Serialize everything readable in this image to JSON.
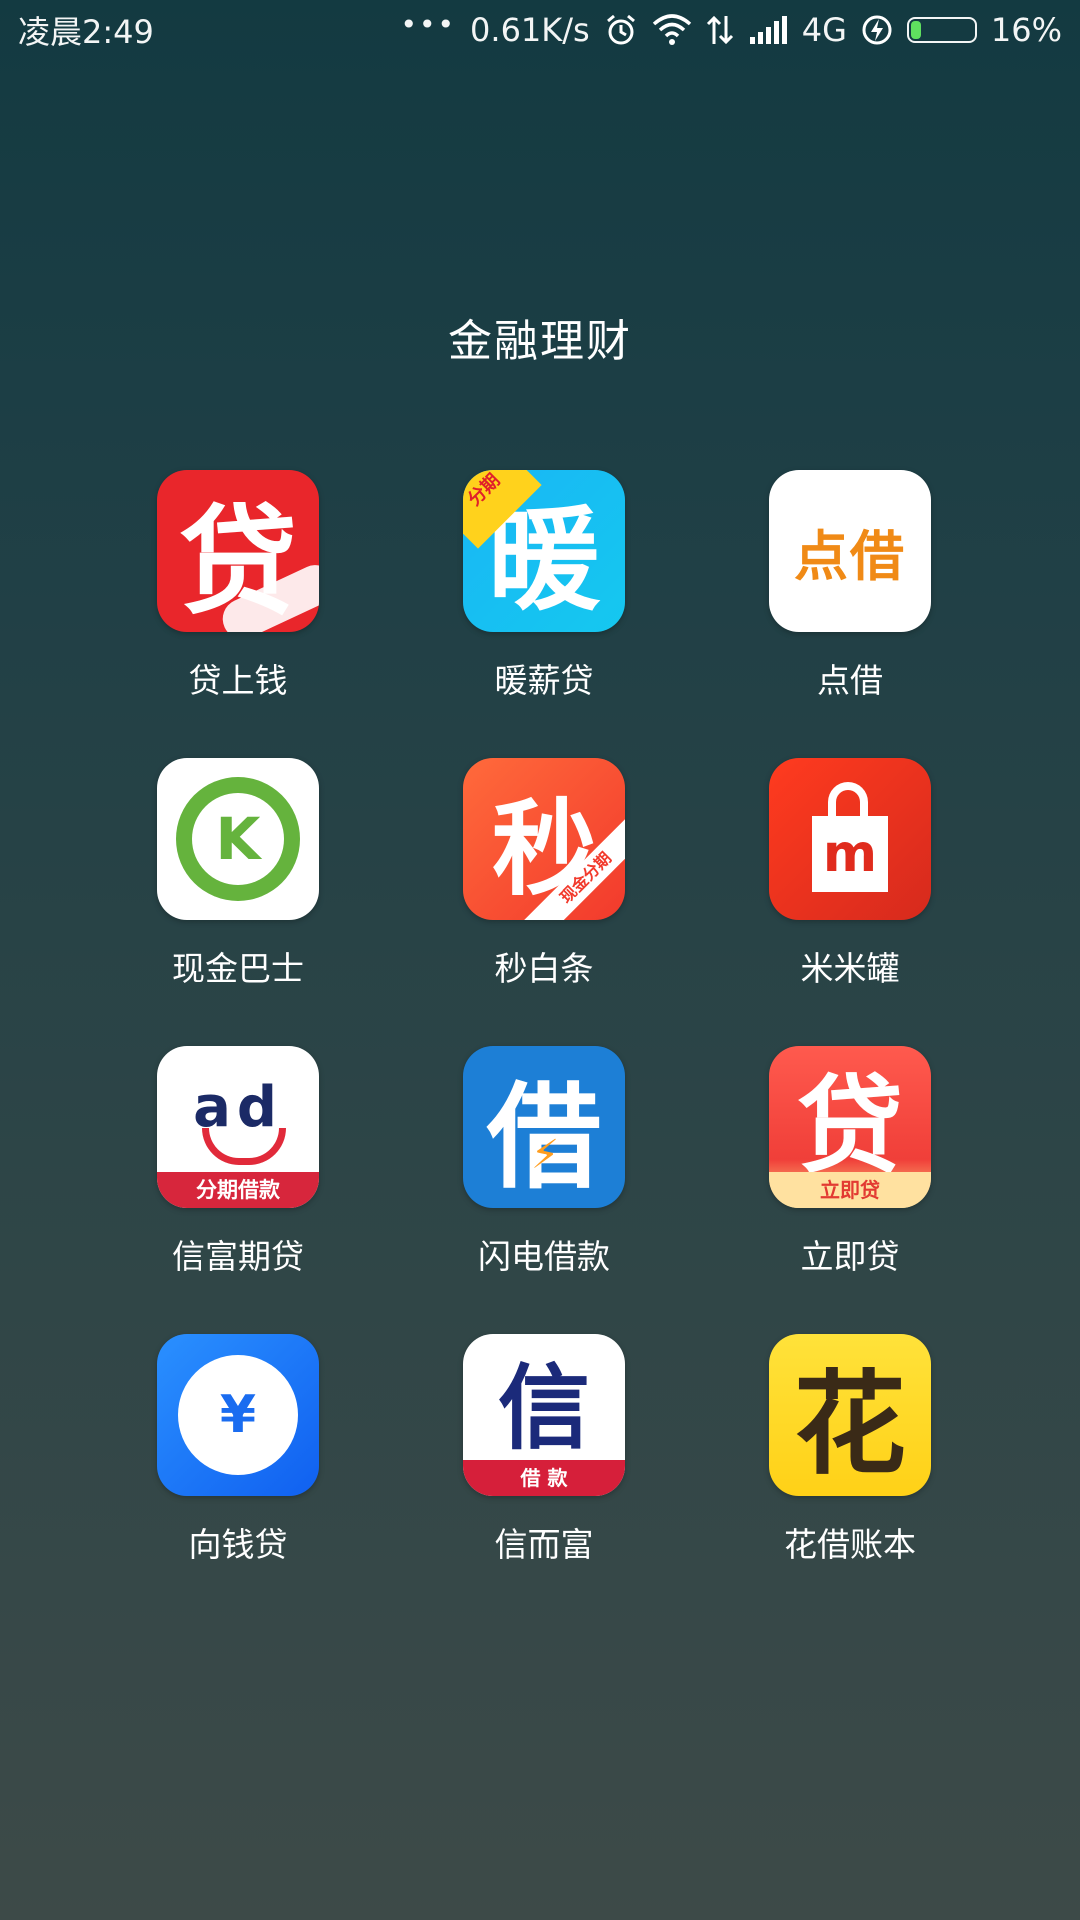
{
  "status_bar": {
    "time": "凌晨2:49",
    "network_speed": "0.61K/s",
    "network_type": "4G",
    "battery_percent": "16%",
    "battery_level": 0.16,
    "icons": [
      "more-dots-icon",
      "alarm-icon",
      "wifi-icon",
      "data-arrows-icon",
      "signal-icon",
      "charging-icon",
      "battery-icon"
    ]
  },
  "folder": {
    "title": "金融理财"
  },
  "apps": [
    {
      "label": "贷上钱",
      "icon": {
        "glyph": "贷"
      }
    },
    {
      "label": "暖薪贷",
      "icon": {
        "glyph": "暖",
        "corner": "分期"
      }
    },
    {
      "label": "点借",
      "icon": {
        "glyph": "点借"
      }
    },
    {
      "label": "现金巴士",
      "icon": {
        "glyph": "K"
      }
    },
    {
      "label": "秒白条",
      "icon": {
        "glyph": "秒",
        "ribbon": "现金分期"
      }
    },
    {
      "label": "米米罐",
      "icon": {
        "glyph": "m"
      }
    },
    {
      "label": "信富期贷",
      "icon": {
        "glyph": "ad",
        "band": "分期借款"
      }
    },
    {
      "label": "闪电借款",
      "icon": {
        "glyph": "借"
      }
    },
    {
      "label": "立即贷",
      "icon": {
        "glyph": "贷",
        "band": "立即贷"
      }
    },
    {
      "label": "向钱贷",
      "icon": {
        "glyph": "¥"
      }
    },
    {
      "label": "信而富",
      "icon": {
        "glyph": "信",
        "band": "借 款"
      }
    },
    {
      "label": "花借账本",
      "icon": {
        "glyph": "花"
      }
    }
  ],
  "colors": {
    "battery_fill": "#5fe05f",
    "background_top": "#133a41",
    "background_bottom": "#3d4a48"
  }
}
